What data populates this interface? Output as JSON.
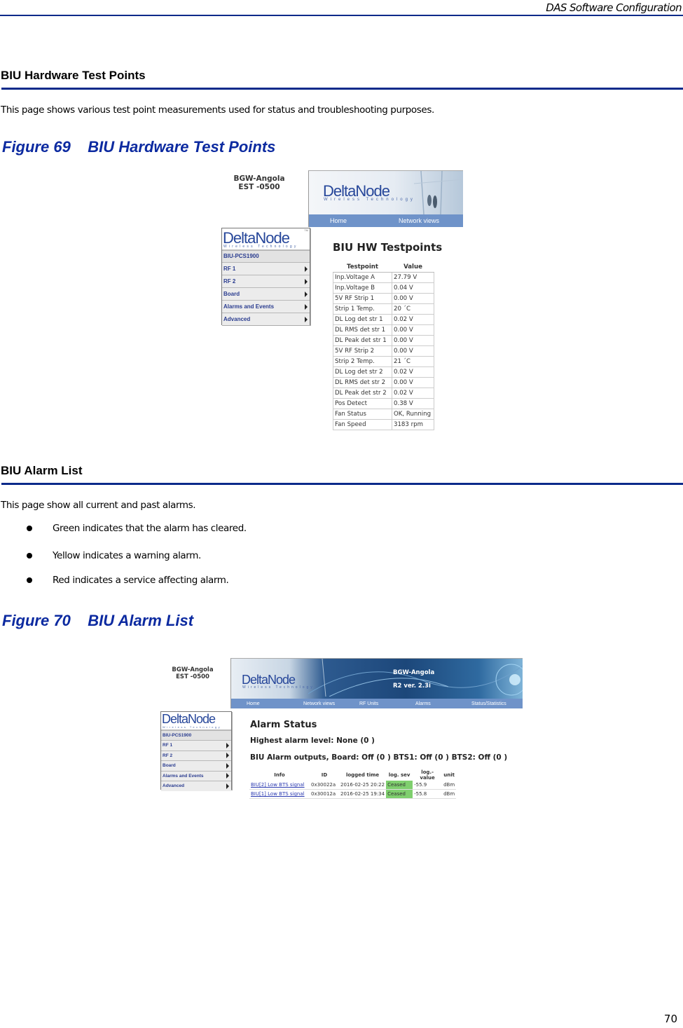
{
  "running_head": "DAS Software Configuration",
  "page_number": "70",
  "sections": [
    {
      "heading": "BIU Hardware Test Points",
      "body": "This page shows various test point measurements used for status and troubleshooting purposes.",
      "figure_caption": "Figure 69    BIU Hardware Test Points"
    },
    {
      "heading": "BIU Alarm List",
      "body": "This page show all current and past alarms.",
      "bullets": [
        "Green indicates that the alarm has cleared.",
        "Yellow indicates a warning alarm.",
        "Red indicates a service affecting alarm."
      ],
      "figure_caption": "Figure 70    BIU Alarm List"
    }
  ],
  "fig69": {
    "site_name": "BGW-Angola",
    "timezone": "EST -0500",
    "logo": "DeltaNode",
    "logo_sub": "Wireless Technology",
    "logo_tm": "TM",
    "nav": [
      "Home",
      "Network views"
    ],
    "sidebar": {
      "device": "BIU-PCS1900",
      "items": [
        "RF 1",
        "RF 2",
        "Board",
        "Alarms and Events",
        "Advanced"
      ]
    },
    "title": "BIU HW Testpoints",
    "table": {
      "headers": [
        "Testpoint",
        "Value"
      ],
      "rows": [
        [
          "Inp.Voltage A",
          "27.79 V"
        ],
        [
          "Inp.Voltage B",
          "0.04 V"
        ],
        [
          "5V RF Strip 1",
          "0.00 V"
        ],
        [
          "Strip 1 Temp.",
          "20 ´C"
        ],
        [
          "DL Log det str 1",
          "0.02 V"
        ],
        [
          "DL RMS det str 1",
          "0.00 V"
        ],
        [
          "DL Peak det str 1",
          "0.00 V"
        ],
        [
          "5V RF Strip 2",
          "0.00 V"
        ],
        [
          "Strip 2 Temp.",
          "21 ´C"
        ],
        [
          "DL Log det str 2",
          "0.02 V"
        ],
        [
          "DL RMS det str 2",
          "0.00 V"
        ],
        [
          "DL Peak det str 2",
          "0.02 V"
        ],
        [
          "Pos Detect",
          "0.38 V"
        ],
        [
          "Fan Status",
          "OK, Running"
        ],
        [
          "Fan Speed",
          "3183 rpm"
        ]
      ]
    }
  },
  "fig70": {
    "site_name": "BGW-Angola",
    "timezone": "EST -0500",
    "logo": "DeltaNode",
    "logo_sub": "Wireless Technology",
    "banner_site": "BGW-Angola",
    "banner_version": "R2 ver. 2.3i",
    "nav": [
      "Home",
      "Network views",
      "RF Units",
      "Alarms",
      "Status/Statistics"
    ],
    "sidebar": {
      "device": "BIU-PCS1900",
      "items": [
        "RF 1",
        "RF 2",
        "Board",
        "Alarms and Events",
        "Advanced"
      ]
    },
    "title": "Alarm Status",
    "highest_level": "Highest alarm level: None (0 )",
    "outputs": "BIU Alarm outputs, Board: Off (0 ) BTS1: Off (0 ) BTS2: Off (0 )",
    "table": {
      "headers": [
        "Info",
        "ID",
        "logged time",
        "log. sev",
        "log.-value",
        "unit"
      ],
      "rows": [
        [
          "BIU[2] Low BTS signal",
          "0x30022a",
          "2016-02-25 20:22",
          "Ceased",
          "-55.9",
          "dBm"
        ],
        [
          "BIU[1] Low BTS signal",
          "0x30012a",
          "2016-02-25 19:34",
          "Ceased",
          "-55.8",
          "dBm"
        ]
      ],
      "ceased_color": "#7fcf6e"
    }
  }
}
